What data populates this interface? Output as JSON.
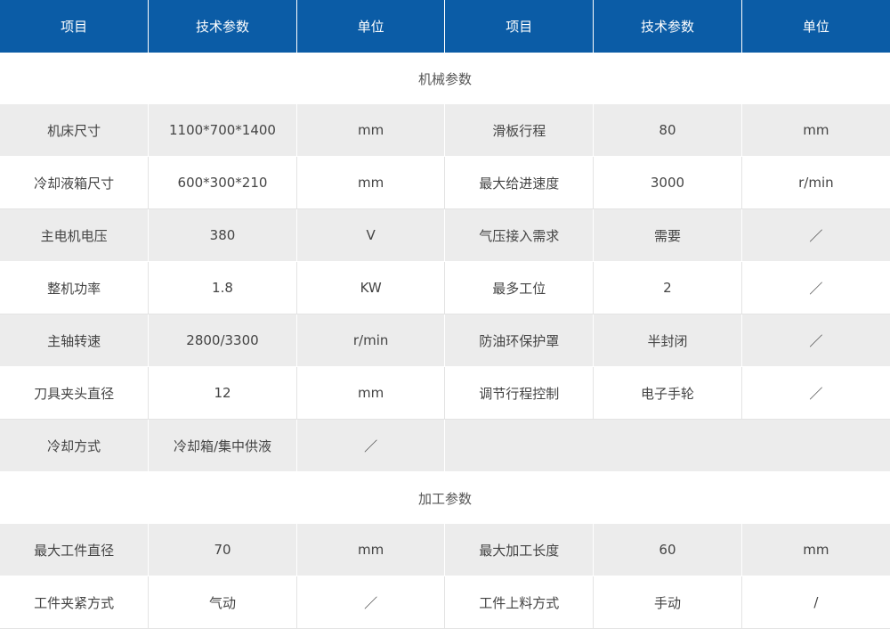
{
  "header": [
    "项目",
    "技术参数",
    "单位",
    "项目",
    "技术参数",
    "单位"
  ],
  "sections": {
    "mechanical": "机械参数",
    "processing": "加工参数"
  },
  "mechanical_rows": [
    [
      "机床尺寸",
      "1100*700*1400",
      "mm",
      "滑板行程",
      "80",
      "mm"
    ],
    [
      "冷却液箱尺寸",
      "600*300*210",
      "mm",
      "最大给进速度",
      "3000",
      "r/min"
    ],
    [
      "主电机电压",
      "380",
      "V",
      "气压接入需求",
      "需要",
      "／"
    ],
    [
      "整机功率",
      "1.8",
      "KW",
      "最多工位",
      "2",
      "／"
    ],
    [
      "主轴转速",
      "2800/3300",
      "r/min",
      "防油环保护罩",
      "半封闭",
      "／"
    ],
    [
      "刀具夹头直径",
      "12",
      "mm",
      "调节行程控制",
      "电子手轮",
      "／"
    ],
    [
      "冷却方式",
      "冷却箱/集中供液",
      "／",
      "",
      "",
      ""
    ]
  ],
  "processing_rows": [
    [
      "最大工件直径",
      "70",
      "mm",
      "最大加工长度",
      "60",
      "mm"
    ],
    [
      "工件夹紧方式",
      "气动",
      "／",
      "工件上料方式",
      "手动",
      "/"
    ]
  ]
}
